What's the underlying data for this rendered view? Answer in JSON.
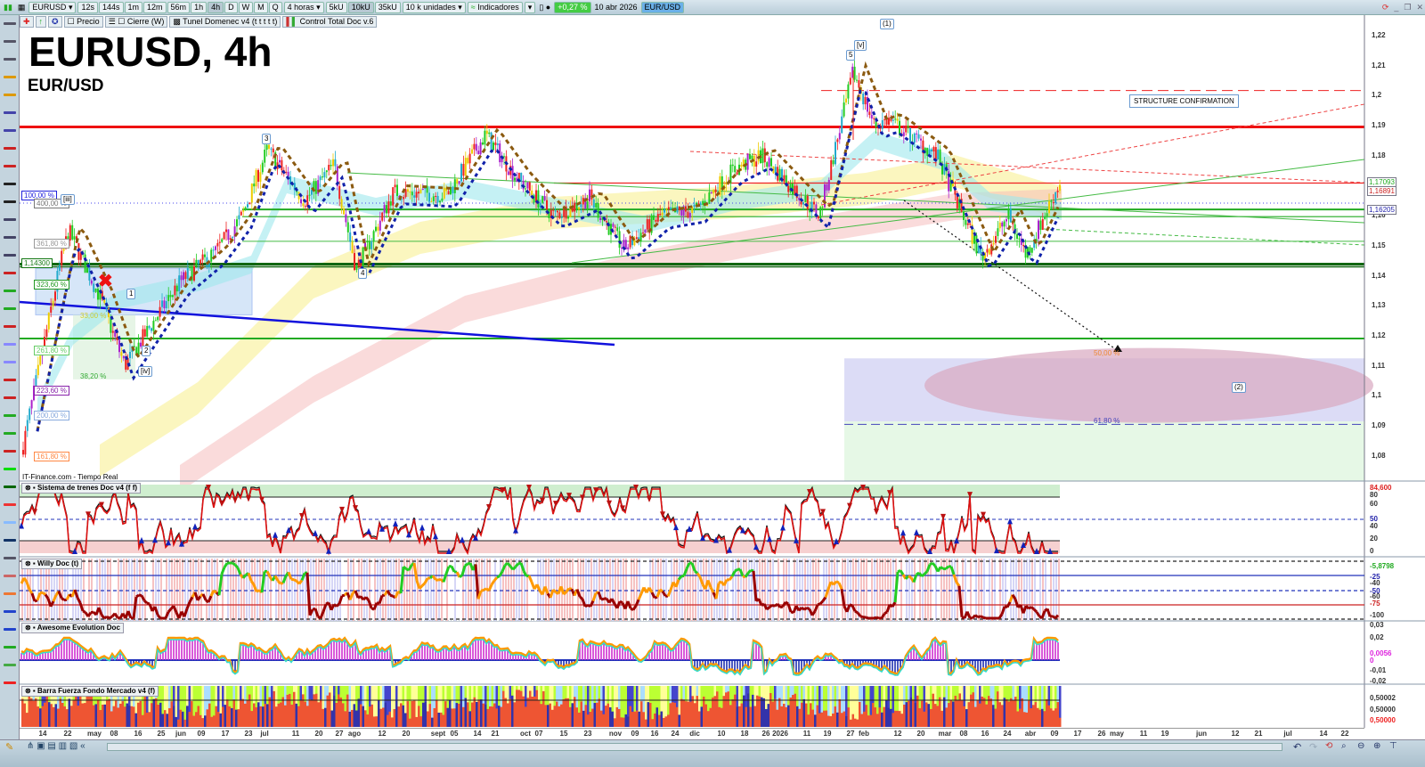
{
  "toolbar": {
    "symbol": "EURUSD",
    "timeframes": [
      "12s",
      "144s",
      "1m",
      "12m",
      "56m",
      "1h",
      "4h",
      "D",
      "W",
      "M",
      "Q"
    ],
    "active_timeframe": "4h",
    "period": "4 horas",
    "volumes": [
      "5kU",
      "10kU",
      "35kU"
    ],
    "active_volume": "10kU",
    "units": "10 k unidades",
    "indicators": "Indicadores",
    "change": "+0,27 %",
    "date": "10 abr 2026",
    "pair_badge": "EUR/USD"
  },
  "overlays": [
    "Precio",
    "Cierre (W)",
    "Tunel Domenec v4 (t t t t t)",
    "Control Total Doc v.6"
  ],
  "chart": {
    "title": "EURUSD, 4h",
    "subtitle": "EUR/USD",
    "source": "IT-Finance.com - Tiempo Real",
    "price_ticks": [
      "1,22",
      "1,21",
      "1,2",
      "1,19",
      "1,18",
      "1,17",
      "1,16",
      "1,15",
      "1,14",
      "1,13",
      "1,12",
      "1,11",
      "1,1",
      "1,09",
      "1,08"
    ],
    "price_tags": [
      {
        "text": "1,17093",
        "color": "#22aa22"
      },
      {
        "text": "1,16891",
        "color": "#cc2222"
      },
      {
        "text": "1,16205",
        "color": "#2222aa"
      }
    ],
    "fib_labels": [
      {
        "text": "100,00 %",
        "color": "#2222dd"
      },
      {
        "text": "400,00 %",
        "color": "#777777"
      },
      {
        "text": "361,80 %",
        "color": "#999999"
      },
      {
        "text": "1,14300",
        "color": "#117711"
      },
      {
        "text": "323,60 %",
        "color": "#229922"
      },
      {
        "text": "261,80 %",
        "color": "#66cc66"
      },
      {
        "text": "223,60 %",
        "color": "#8822aa"
      },
      {
        "text": "200,00 %",
        "color": "#88aadd"
      },
      {
        "text": "161,80 %",
        "color": "#ff8844"
      }
    ],
    "inner_labels": {
      "r33": "33,00 %",
      "r38": "38,20 %",
      "r50": "50,00 %",
      "r618": "61,80 %",
      "structure": "STRUCTURE CONFIRMATION"
    },
    "waves": [
      "(1)",
      "[v]",
      "5",
      "3",
      "4",
      "1",
      "2",
      "[iv]",
      "(2)",
      "[iii]"
    ]
  },
  "panels": [
    {
      "title": "Sistema de trenes Doc v4 (f f)",
      "ticks": [
        "84,600",
        "80",
        "60",
        "50",
        "40",
        "20",
        "0"
      ]
    },
    {
      "title": "Willy Doc (t)",
      "ticks": [
        "-5,8798",
        "-25",
        "-40",
        "-50",
        "-60",
        "-75",
        "-100"
      ]
    },
    {
      "title": "Awesome Evolution Doc",
      "ticks": [
        "0,03",
        "0,02",
        "0,0056",
        "0",
        "-0,01",
        "-0,02"
      ]
    },
    {
      "title": "Barra Fuerza Fondo Mercado v4 (f)",
      "ticks": [
        "0,50002",
        "0,50000",
        "0,50000"
      ]
    }
  ],
  "time_axis": [
    "14",
    "22",
    "may",
    "08",
    "16",
    "25",
    "jun",
    "09",
    "17",
    "23",
    "jul",
    "11",
    "20",
    "27",
    "ago",
    "12",
    "20",
    "sept",
    "05",
    "14",
    "21",
    "oct",
    "07",
    "15",
    "23",
    "nov",
    "09",
    "16",
    "24",
    "dic",
    "10",
    "18",
    "26",
    "2026",
    "11",
    "19",
    "27",
    "feb",
    "12",
    "20",
    "mar",
    "08",
    "16",
    "24",
    "abr",
    "09",
    "17",
    "26",
    "may",
    "11",
    "19",
    "jun",
    "12",
    "21",
    "jul",
    "14",
    "22"
  ]
}
